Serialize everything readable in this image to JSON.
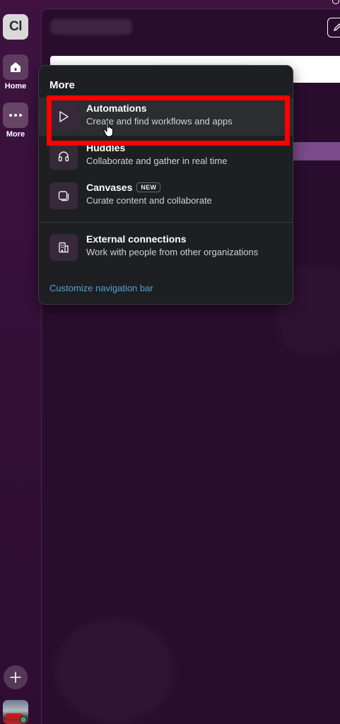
{
  "rail": {
    "workspace_initials": "Cl",
    "home_label": "Home",
    "more_label": "More"
  },
  "popover": {
    "title": "More",
    "items": [
      {
        "title": "Automations",
        "description": "Create and find workflows and apps",
        "icon": "play-icon",
        "badge": ""
      },
      {
        "title": "Huddles",
        "description": "Collaborate and gather in real time",
        "icon": "headphones-icon",
        "badge": ""
      },
      {
        "title": "Canvases",
        "description": "Curate content and collaborate",
        "icon": "canvas-icon",
        "badge": "NEW"
      },
      {
        "title": "External connections",
        "description": "Work with people from other organizations",
        "icon": "building-icon",
        "badge": ""
      }
    ],
    "customize_link": "Customize navigation bar"
  },
  "colors": {
    "background": "#3b0f3a",
    "popover_bg": "#1e1f22",
    "link": "#4fa3d6",
    "highlight": "#ff0000"
  }
}
